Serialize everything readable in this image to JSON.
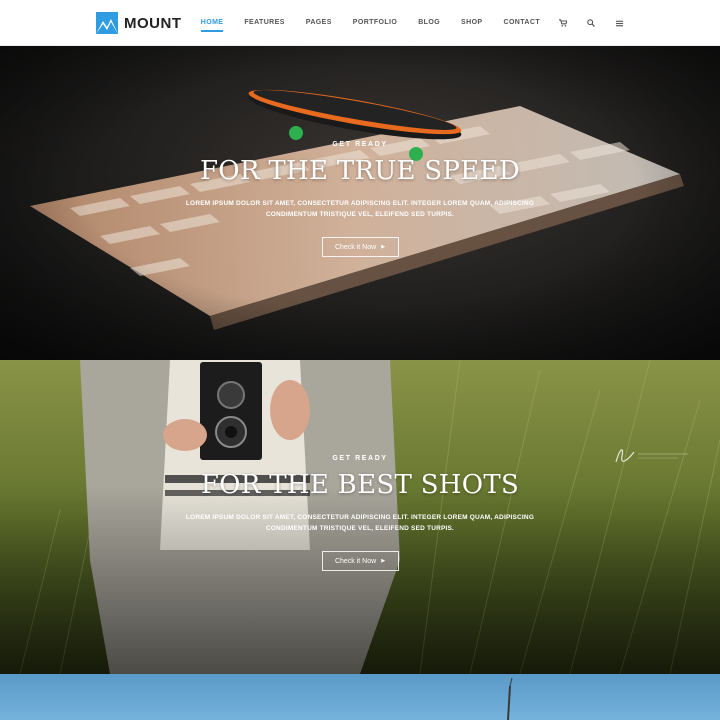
{
  "brand": {
    "name": "MOUNT",
    "accent": "#2f9be0"
  },
  "nav": {
    "items": [
      {
        "label": "HOME",
        "active": true
      },
      {
        "label": "FEATURES",
        "active": false
      },
      {
        "label": "PAGES",
        "active": false
      },
      {
        "label": "PORTFOLIO",
        "active": false
      },
      {
        "label": "BLOG",
        "active": false
      },
      {
        "label": "SHOP",
        "active": false
      },
      {
        "label": "CONTACT",
        "active": false
      }
    ],
    "icons": [
      "cart-icon",
      "search-icon",
      "menu-icon"
    ]
  },
  "slides": [
    {
      "eyebrow": "GET READY",
      "headline": "FOR THE TRUE SPEED",
      "body_line1": "LOREM IPSUM DOLOR SIT AMET, CONSECTETUR ADIPISCING ELIT. INTEGER LOREM QUAM, ADIPISCING",
      "body_line2": "CONDIMENTUM TRISTIQUE VEL, ELEIFEND SED TURPIS.",
      "cta": "Check it Now"
    },
    {
      "eyebrow": "GET READY",
      "headline": "FOR THE BEST SHOTS",
      "body_line1": "LOREM IPSUM DOLOR SIT AMET, CONSECTETUR ADIPISCING ELIT. INTEGER LOREM QUAM, ADIPISCING",
      "body_line2": "CONDIMENTUM TRISTIQUE VEL, ELEIFEND SED TURPIS.",
      "cta": "Check it Now"
    }
  ]
}
